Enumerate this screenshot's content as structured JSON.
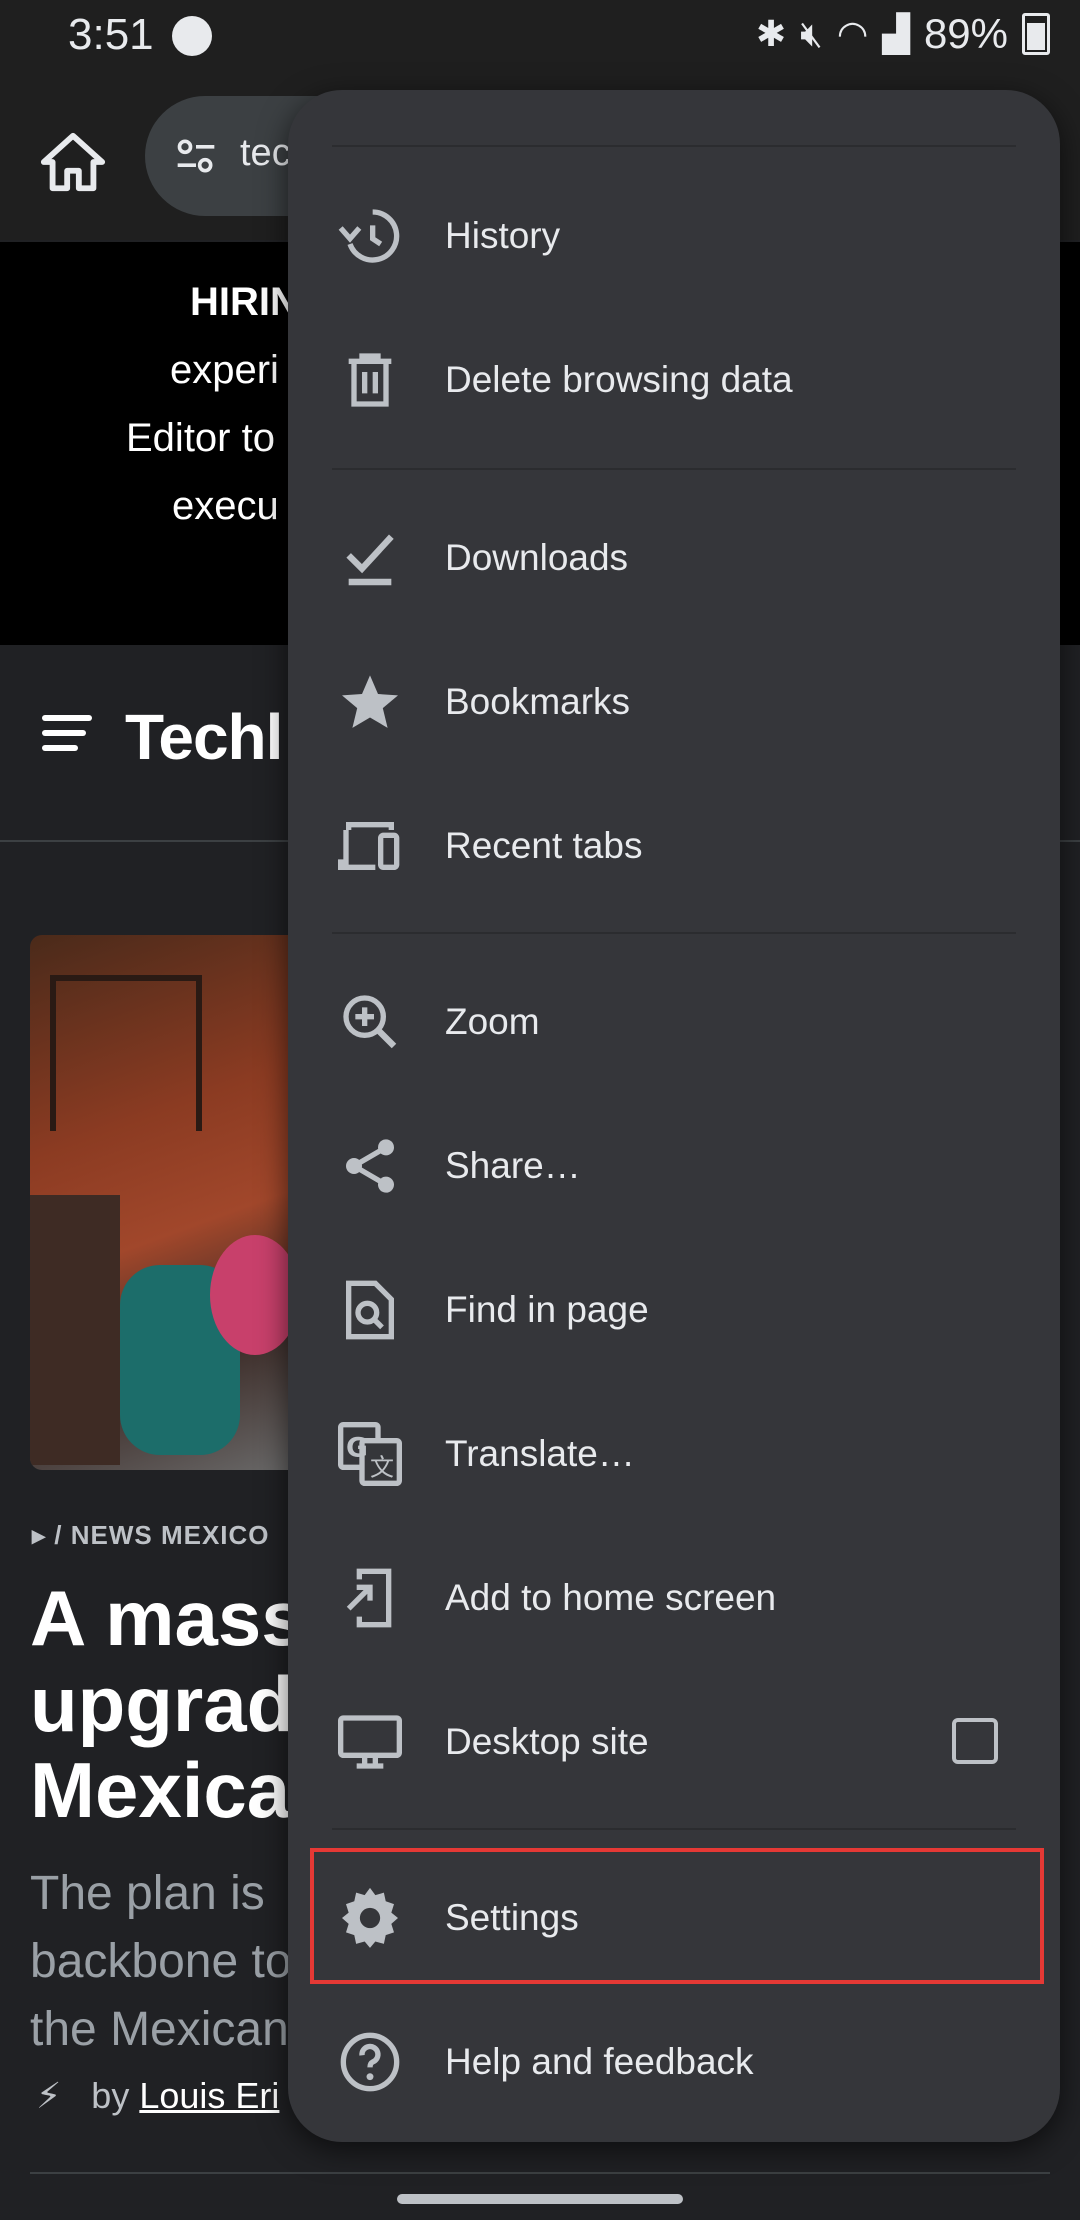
{
  "status_bar": {
    "time": "3:51",
    "battery_text": "89%",
    "icons": [
      "spotify-icon",
      "bluetooth-icon",
      "mute-icon",
      "wifi-icon",
      "signal-icon",
      "battery-icon"
    ]
  },
  "toolbar": {
    "url_partial": "tec"
  },
  "banner": {
    "lines": [
      "HIRIN",
      "experi",
      "Editor to",
      "execu"
    ]
  },
  "site": {
    "logo_partial": "Techl"
  },
  "article": {
    "kicker": "/ NEWS  MEXICO",
    "headline_lines": [
      "A mass",
      "upgrad",
      "Mexica"
    ],
    "dek_lines": [
      "The plan is",
      "backbone to",
      "the Mexican"
    ],
    "by": "by",
    "author_partial": "Louis Eri"
  },
  "menu": {
    "items": [
      {
        "label": "History",
        "icon": "history-icon"
      },
      {
        "label": "Delete browsing data",
        "icon": "trash-icon"
      },
      {
        "label": "Downloads",
        "icon": "download-icon"
      },
      {
        "label": "Bookmarks",
        "icon": "star-icon"
      },
      {
        "label": "Recent tabs",
        "icon": "devices-icon"
      },
      {
        "label": "Zoom",
        "icon": "zoom-icon"
      },
      {
        "label": "Share…",
        "icon": "share-icon"
      },
      {
        "label": "Find in page",
        "icon": "find-in-page-icon"
      },
      {
        "label": "Translate…",
        "icon": "translate-icon"
      },
      {
        "label": "Add to home screen",
        "icon": "add-to-home-icon"
      },
      {
        "label": "Desktop site",
        "icon": "desktop-icon",
        "checkbox_checked": false
      },
      {
        "label": "Settings",
        "icon": "gear-icon",
        "highlighted": true
      },
      {
        "label": "Help and feedback",
        "icon": "help-icon"
      }
    ]
  },
  "colors": {
    "menu_bg": "#35363a",
    "page_bg": "#202124",
    "highlight_border": "#e53935"
  }
}
